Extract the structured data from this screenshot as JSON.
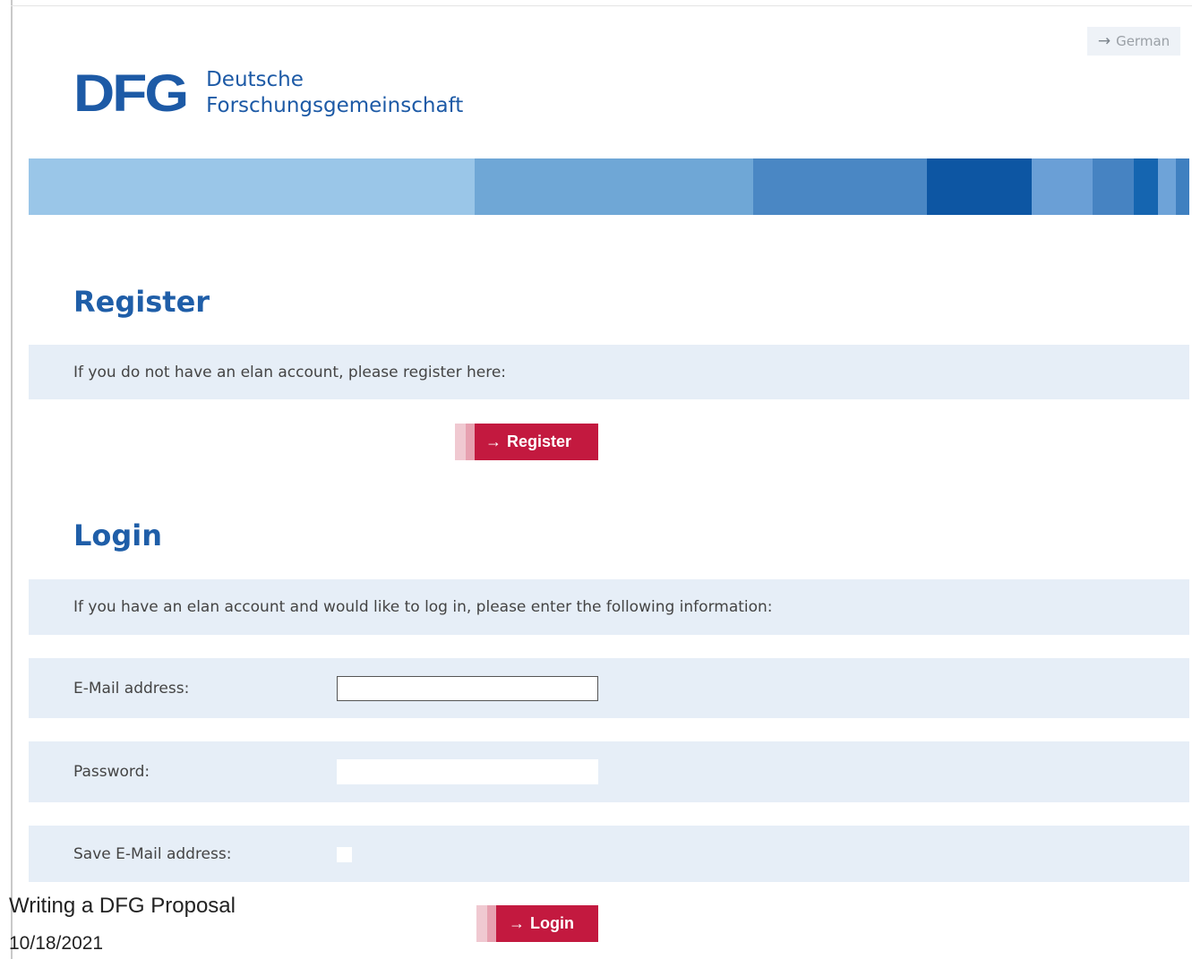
{
  "language_switch": {
    "arrow": "→",
    "label": "German"
  },
  "logo": {
    "mark": "DFG",
    "line1": "Deutsche",
    "line2": "Forschungsgemeinschaft"
  },
  "banner_colors": [
    "#9ac6e8",
    "#6fa7d6",
    "#4a87c4",
    "#0d56a3",
    "#6a9fd6",
    "#4683c2",
    "#1565b0",
    "#6ea3d8",
    "#3f80c0"
  ],
  "register": {
    "title": "Register",
    "info": "If you do not have an elan account, please register here:",
    "button_arrow": "→",
    "button_label": "Register"
  },
  "login": {
    "title": "Login",
    "info": "If you have an elan account and would like to log in, please enter the following information:",
    "email_label": "E-Mail address:",
    "email_value": "",
    "password_label": "Password:",
    "password_value": "",
    "save_label": "Save E-Mail address:",
    "save_checked": false,
    "button_arrow": "→",
    "button_label": "Login"
  },
  "footer": {
    "title": "Writing a DFG Proposal",
    "date": "10/18/2021"
  },
  "colors": {
    "brand_blue": "#1d5aa6",
    "button_red": "#c3193f",
    "row_bg": "#e6eef7"
  }
}
